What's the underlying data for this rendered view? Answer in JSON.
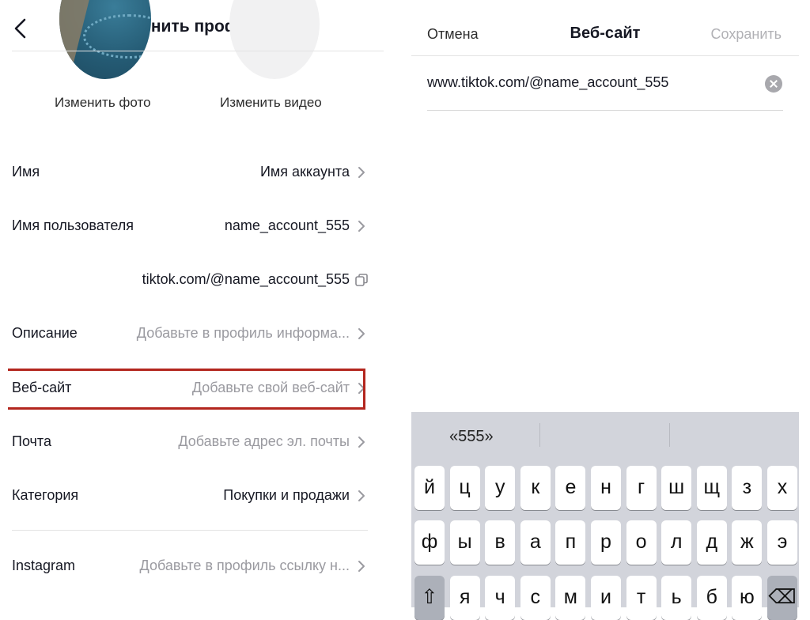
{
  "left": {
    "title": "Изменить профиль",
    "change_photo": "Изменить фото",
    "change_video": "Изменить видео",
    "rows": [
      {
        "label": "Имя",
        "value": "Имя аккаунта"
      },
      {
        "label": "Имя пользователя",
        "value": "name_account_555"
      },
      {
        "label": "",
        "value": "tiktok.com/@name_account_555"
      },
      {
        "label": "Описание",
        "value": "Добавьте в профиль информа..."
      },
      {
        "label": "Веб-сайт",
        "value": "Добавьте свой веб-сайт"
      },
      {
        "label": "Почта",
        "value": "Добавьте адрес эл. почты"
      },
      {
        "label": "Категория",
        "value": "Покупки и продажи"
      },
      {
        "label": "Instagram",
        "value": "Добавьте в профиль ссылку н..."
      }
    ],
    "highlight_color": "#b3261e"
  },
  "right": {
    "cancel": "Отмена",
    "title": "Веб-сайт",
    "save": "Сохранить",
    "input_value": "www.tiktok.com/@name_account_555"
  },
  "keyboard": {
    "suggestion": "«555»",
    "row1": [
      "й",
      "ц",
      "у",
      "к",
      "е",
      "н",
      "г",
      "ш",
      "щ",
      "з",
      "х"
    ],
    "row2": [
      "ф",
      "ы",
      "в",
      "а",
      "п",
      "р",
      "о",
      "л",
      "д",
      "ж",
      "э"
    ],
    "row3": [
      "⇧",
      "я",
      "ч",
      "с",
      "м",
      "и",
      "т",
      "ь",
      "б",
      "ю",
      "⌫"
    ]
  }
}
